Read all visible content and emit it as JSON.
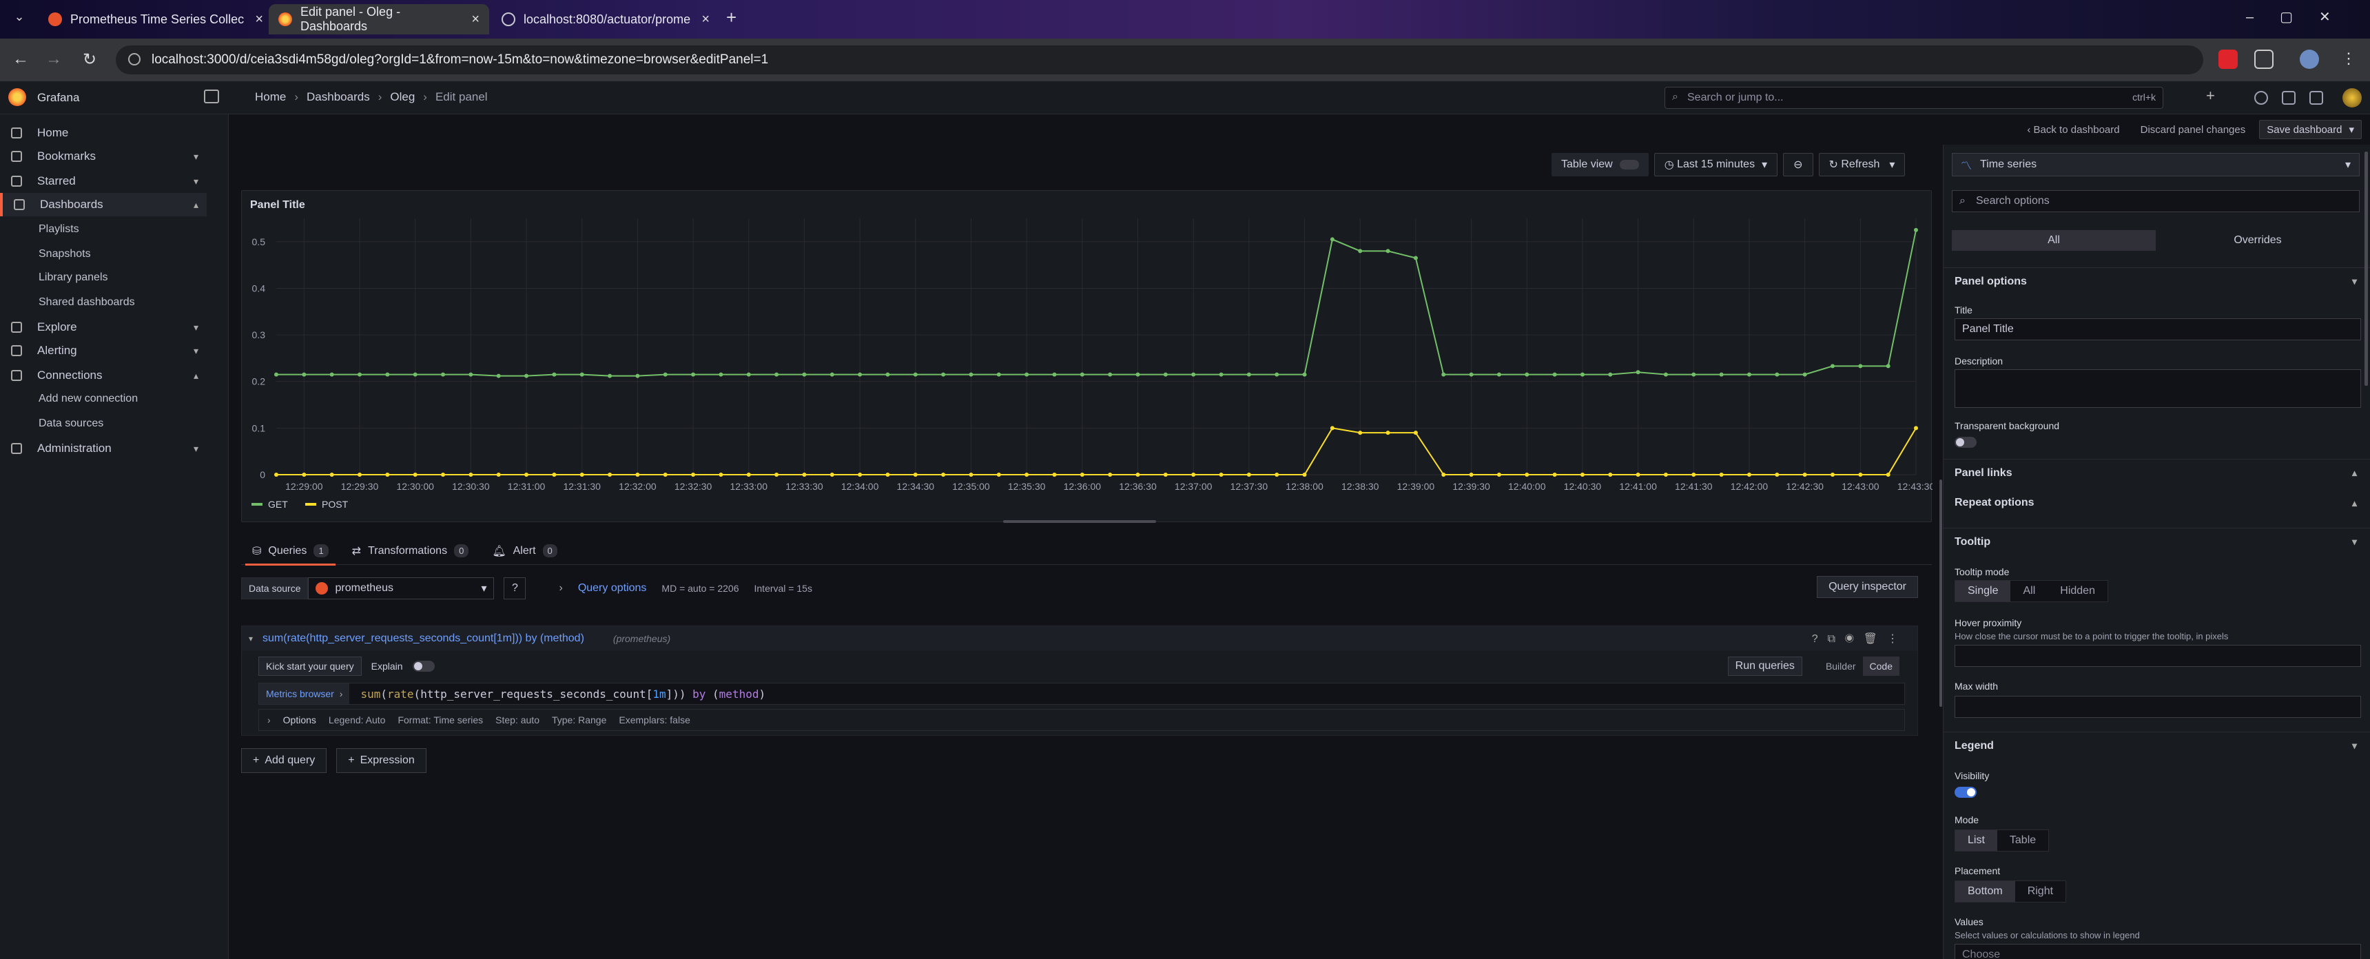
{
  "browser": {
    "tabs": [
      {
        "title": "Prometheus Time Series Collec",
        "active": false
      },
      {
        "title": "Edit panel - Oleg - Dashboards",
        "active": true
      },
      {
        "title": "localhost:8080/actuator/prome",
        "active": false
      }
    ],
    "url": "localhost:3000/d/ceia3sdi4m58gd/oleg?orgId=1&from=now-15m&to=now&timezone=browser&editPanel=1"
  },
  "topbar": {
    "brand": "Grafana",
    "breadcrumb": [
      "Home",
      "Dashboards",
      "Oleg",
      "Edit panel"
    ],
    "search_placeholder": "Search or jump to...",
    "search_shortcut": "ctrl+k"
  },
  "sidebar": {
    "items": [
      {
        "label": "Home",
        "sub": false
      },
      {
        "label": "Bookmarks",
        "sub": false
      },
      {
        "label": "Starred",
        "sub": false
      },
      {
        "label": "Dashboards",
        "sub": false
      },
      {
        "label": "Playlists",
        "sub": true
      },
      {
        "label": "Snapshots",
        "sub": true
      },
      {
        "label": "Library panels",
        "sub": true
      },
      {
        "label": "Shared dashboards",
        "sub": true
      },
      {
        "label": "Explore",
        "sub": false
      },
      {
        "label": "Alerting",
        "sub": false
      },
      {
        "label": "Connections",
        "sub": false
      },
      {
        "label": "Add new connection",
        "sub": true
      },
      {
        "label": "Data sources",
        "sub": true
      },
      {
        "label": "Administration",
        "sub": false
      }
    ]
  },
  "actions": {
    "back": "Back to dashboard",
    "discard": "Discard panel changes",
    "save": "Save dashboard"
  },
  "panel_controls": {
    "table_view": "Table view",
    "time_range": "Last 15 minutes",
    "refresh": "Refresh"
  },
  "panel": {
    "title": "Panel Title"
  },
  "chart_data": {
    "type": "line",
    "x": [
      "12:28:45",
      "12:29:00",
      "12:29:15",
      "12:29:30",
      "12:29:45",
      "12:30:00",
      "12:30:15",
      "12:30:30",
      "12:30:45",
      "12:31:00",
      "12:31:15",
      "12:31:30",
      "12:31:45",
      "12:32:00",
      "12:32:15",
      "12:32:30",
      "12:32:45",
      "12:33:00",
      "12:33:15",
      "12:33:30",
      "12:33:45",
      "12:34:00",
      "12:34:15",
      "12:34:30",
      "12:34:45",
      "12:35:00",
      "12:35:15",
      "12:35:30",
      "12:35:45",
      "12:36:00",
      "12:36:15",
      "12:36:30",
      "12:36:45",
      "12:37:00",
      "12:37:15",
      "12:37:30",
      "12:37:45",
      "12:38:00",
      "12:38:15",
      "12:38:30",
      "12:38:45",
      "12:39:00",
      "12:39:15",
      "12:39:30",
      "12:39:45",
      "12:40:00",
      "12:40:15",
      "12:40:30",
      "12:40:45",
      "12:41:00",
      "12:41:15",
      "12:41:30",
      "12:41:45",
      "12:42:00",
      "12:42:15",
      "12:42:30",
      "12:42:45",
      "12:43:00",
      "12:43:15",
      "12:43:30"
    ],
    "series": [
      {
        "name": "GET",
        "color": "#73bf69",
        "values": [
          0.215,
          0.215,
          0.215,
          0.215,
          0.215,
          0.215,
          0.215,
          0.215,
          0.212,
          0.212,
          0.215,
          0.215,
          0.212,
          0.212,
          0.215,
          0.215,
          0.215,
          0.215,
          0.215,
          0.215,
          0.215,
          0.215,
          0.215,
          0.215,
          0.215,
          0.215,
          0.215,
          0.215,
          0.215,
          0.215,
          0.215,
          0.215,
          0.215,
          0.215,
          0.215,
          0.215,
          0.215,
          0.215,
          0.505,
          0.48,
          0.48,
          0.465,
          0.215,
          0.215,
          0.215,
          0.215,
          0.215,
          0.215,
          0.215,
          0.22,
          0.215,
          0.215,
          0.215,
          0.215,
          0.215,
          0.215,
          0.233,
          0.233,
          0.233,
          0.525,
          0.51
        ]
      },
      {
        "name": "POST",
        "color": "#fade2a",
        "values": [
          0,
          0,
          0,
          0,
          0,
          0,
          0,
          0,
          0,
          0,
          0,
          0,
          0,
          0,
          0,
          0,
          0,
          0,
          0,
          0,
          0,
          0,
          0,
          0,
          0,
          0,
          0,
          0,
          0,
          0,
          0,
          0,
          0,
          0,
          0,
          0,
          0,
          0,
          0.1,
          0.09,
          0.09,
          0.09,
          0,
          0,
          0,
          0,
          0,
          0,
          0,
          0,
          0,
          0,
          0,
          0,
          0,
          0,
          0,
          0,
          0,
          0.1,
          0.1
        ]
      }
    ],
    "ylim": [
      0,
      0.55
    ],
    "yticks": [
      "0",
      "0.1",
      "0.2",
      "0.3",
      "0.4",
      "0.5"
    ],
    "xticks": [
      "12:29:00",
      "12:29:30",
      "12:30:00",
      "12:30:30",
      "12:31:00",
      "12:31:30",
      "12:32:00",
      "12:32:30",
      "12:33:00",
      "12:33:30",
      "12:34:00",
      "12:34:30",
      "12:35:00",
      "12:35:30",
      "12:36:00",
      "12:36:30",
      "12:37:00",
      "12:37:30",
      "12:38:00",
      "12:38:30",
      "12:39:00",
      "12:39:30",
      "12:40:00",
      "12:40:30",
      "12:41:00",
      "12:41:30",
      "12:42:00",
      "12:42:30",
      "12:43:00",
      "12:43:30"
    ],
    "grid": true,
    "legend": "bottom-left"
  },
  "query_tabs": [
    {
      "label": "Queries",
      "count": "1"
    },
    {
      "label": "Transformations",
      "count": "0"
    },
    {
      "label": "Alert",
      "count": "0"
    }
  ],
  "datasource": {
    "label": "Data source",
    "value": "prometheus",
    "query_options": "Query options",
    "md": "MD = auto = 2206",
    "interval": "Interval = 15s",
    "inspector": "Query inspector"
  },
  "query": {
    "header": "sum(rate(http_server_requests_seconds_count[1m])) by (method)",
    "ds_name": "(prometheus)",
    "kick_start": "Kick start your query",
    "explain": "Explain",
    "run": "Run queries",
    "builder": "Builder",
    "code": "Code",
    "metrics_browser": "Metrics browser",
    "expr_fn1": "sum",
    "expr_fn2": "rate",
    "expr_metric": "http_server_requests_seconds_count",
    "expr_range": "1m",
    "expr_by": "by",
    "expr_label": "method",
    "options_label": "Options",
    "opt_legend": "Legend: Auto",
    "opt_format": "Format: Time series",
    "opt_step": "Step: auto",
    "opt_type": "Type: Range",
    "opt_exemplars": "Exemplars: false"
  },
  "add": {
    "query": "Add query",
    "expression": "Expression"
  },
  "options_pane": {
    "viz": "Time series",
    "search_placeholder": "Search options",
    "tab_all": "All",
    "tab_overrides": "Overrides",
    "sec_panel_options": "Panel options",
    "title_label": "Title",
    "title_value": "Panel Title",
    "desc_label": "Description",
    "transparent_label": "Transparent background",
    "panel_links": "Panel links",
    "repeat_options": "Repeat options",
    "tooltip": "Tooltip",
    "tooltip_mode": "Tooltip mode",
    "tooltip_modes": [
      "Single",
      "All",
      "Hidden"
    ],
    "hover_label": "Hover proximity",
    "hover_hint": "How close the cursor must be to a point to trigger the tooltip, in pixels",
    "max_width": "Max width",
    "legend": "Legend",
    "visibility": "Visibility",
    "mode": "Mode",
    "modes": [
      "List",
      "Table"
    ],
    "placement": "Placement",
    "placements": [
      "Bottom",
      "Right"
    ],
    "values": "Values",
    "values_hint": "Select values or calculations to show in legend",
    "choose": "Choose"
  }
}
